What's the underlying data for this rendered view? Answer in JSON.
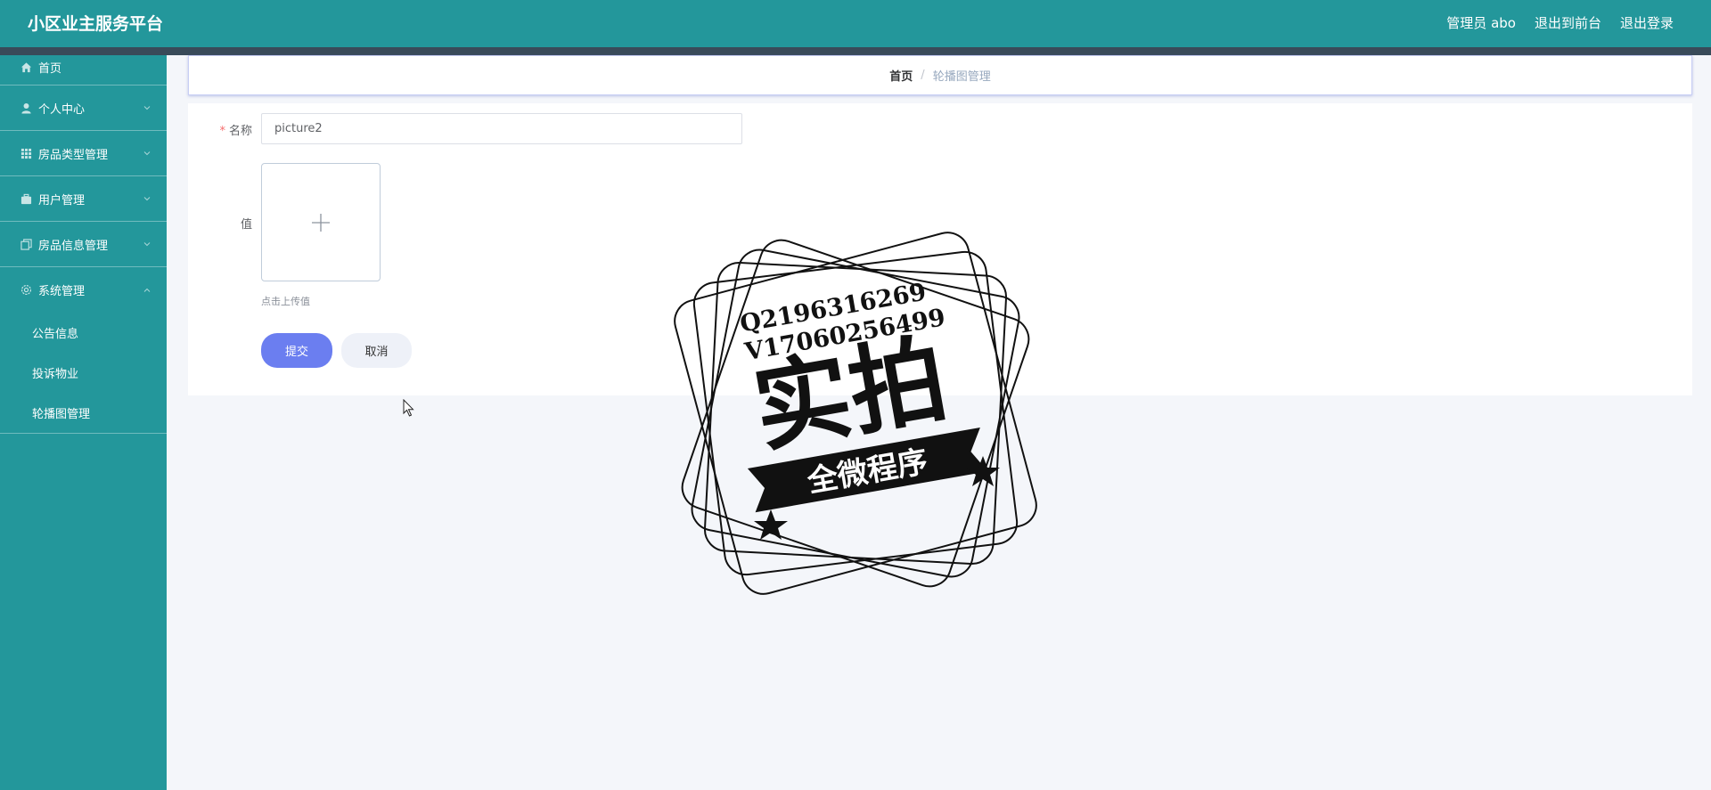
{
  "app": {
    "title": "小区业主服务平台"
  },
  "header": {
    "links": [
      "管理员 abo",
      "退出到前台",
      "退出登录"
    ],
    "colors": {
      "primary": "#23979b",
      "accent_strip": "#394b59"
    }
  },
  "sidebar": {
    "items": [
      {
        "label": "首页",
        "icon": "home-icon"
      },
      {
        "label": "个人中心",
        "icon": "user-icon"
      },
      {
        "label": "房品类型管理",
        "icon": "grid-icon"
      },
      {
        "label": "用户管理",
        "icon": "briefcase-icon"
      },
      {
        "label": "房品信息管理",
        "icon": "copy-icon"
      },
      {
        "label": "系统管理",
        "icon": "settings-icon"
      }
    ],
    "sub_items": [
      "公告信息",
      "投诉物业",
      "轮播图管理"
    ]
  },
  "breadcrumb": {
    "home": "首页",
    "separator": "/",
    "current": "轮播图管理"
  },
  "form": {
    "name_label": "名称",
    "name_value": "picture2",
    "value_label": "值",
    "upload_hint": "点击上传值",
    "submit_label": "提交",
    "cancel_label": "取消"
  },
  "watermark": {
    "line1": "Q2196316269",
    "line2": "V17060256499",
    "big_text": "实拍",
    "ribbon_text": "全微程序"
  }
}
